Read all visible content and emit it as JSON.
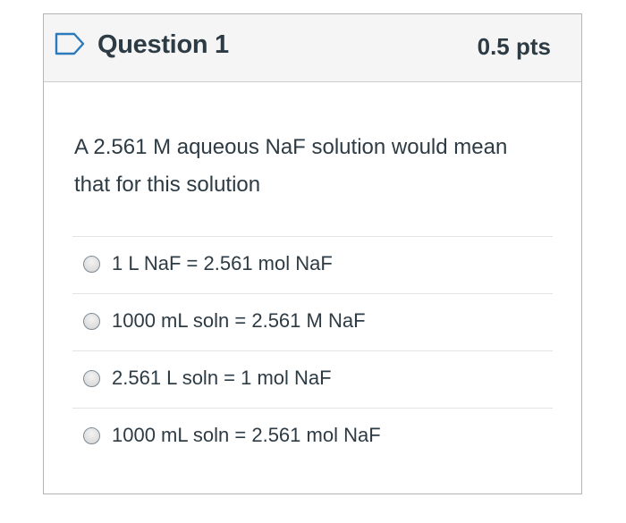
{
  "question": {
    "title": "Question 1",
    "points": "0.5 pts",
    "flag_icon": "bookmark-flag-icon",
    "text": "A 2.561 M aqueous NaF solution would mean that for this solution"
  },
  "answers": [
    {
      "label": "1 L NaF = 2.561 mol NaF",
      "selected": false
    },
    {
      "label": "1000 mL soln = 2.561 M NaF",
      "selected": false
    },
    {
      "label": "2.561 L soln = 1 mol NaF",
      "selected": false
    },
    {
      "label": "1000 mL soln = 2.561 mol NaF",
      "selected": false
    }
  ],
  "colors": {
    "text": "#2d3b45",
    "header_bg": "#f5f5f5",
    "flag": "#2b7abc",
    "border": "#b5b5b5"
  }
}
